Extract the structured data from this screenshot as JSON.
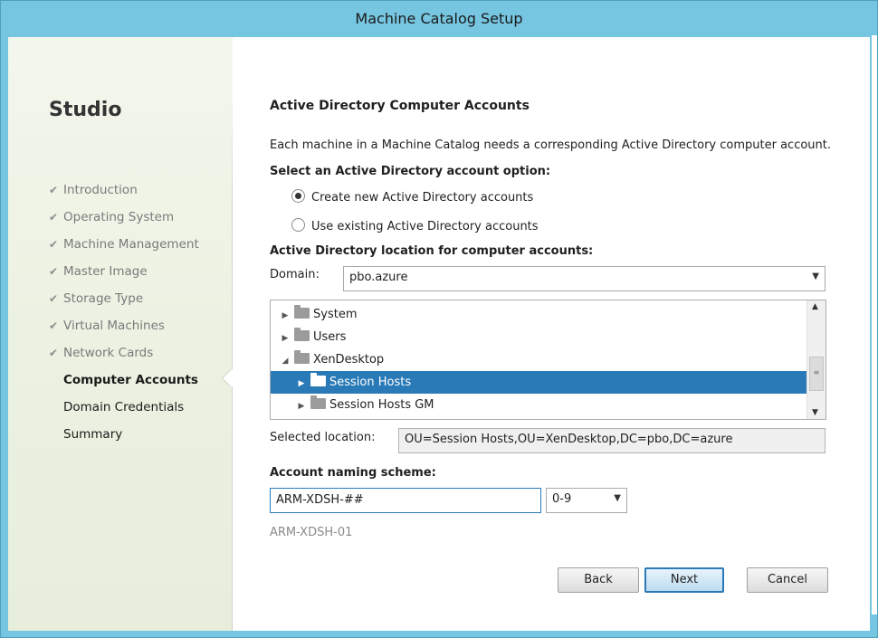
{
  "window": {
    "title": "Machine Catalog Setup"
  },
  "sidebar": {
    "brand": "Studio",
    "steps": [
      {
        "label": "Introduction",
        "state": "done"
      },
      {
        "label": "Operating System",
        "state": "done"
      },
      {
        "label": "Machine Management",
        "state": "done"
      },
      {
        "label": "Master Image",
        "state": "done"
      },
      {
        "label": "Storage Type",
        "state": "done"
      },
      {
        "label": "Virtual Machines",
        "state": "done"
      },
      {
        "label": "Network Cards",
        "state": "done"
      },
      {
        "label": "Computer Accounts",
        "state": "current"
      },
      {
        "label": "Domain Credentials",
        "state": "todo"
      },
      {
        "label": "Summary",
        "state": "todo"
      }
    ]
  },
  "main": {
    "heading": "Active Directory Computer Accounts",
    "description": "Each machine in a Machine Catalog needs a corresponding Active Directory computer account.",
    "option_label": "Select an Active Directory account option:",
    "options": [
      {
        "label": "Create new Active Directory accounts",
        "selected": true
      },
      {
        "label": "Use existing Active Directory accounts",
        "selected": false
      }
    ],
    "location_label": "Active Directory location for computer accounts:",
    "domain_label": "Domain:",
    "domain_value": "pbo.azure",
    "tree": [
      {
        "label": "System",
        "expanded": false,
        "selected": false
      },
      {
        "label": "Users",
        "expanded": false,
        "selected": false
      },
      {
        "label": "XenDesktop",
        "expanded": true,
        "selected": false
      },
      {
        "label": "Session Hosts",
        "expanded": false,
        "selected": true
      },
      {
        "label": "Session Hosts GM",
        "expanded": false,
        "selected": false
      }
    ],
    "selected_location_label": "Selected location:",
    "selected_location_value": "OU=Session Hosts,OU=XenDesktop,DC=pbo,DC=azure",
    "naming_label": "Account naming scheme:",
    "naming_value": "ARM-XDSH-##",
    "naming_type": "0-9",
    "naming_preview": "ARM-XDSH-01"
  },
  "buttons": {
    "back": "Back",
    "next": "Next",
    "cancel": "Cancel"
  },
  "icons": {
    "check": "check-icon",
    "collapsed": "expand-arrow-icon",
    "expanded": "collapse-arrow-icon",
    "folder": "folder-icon",
    "dropdown": "chevron-down-icon"
  },
  "colors": {
    "titlebar": "#76c6e2",
    "selection": "#2a7ab8",
    "sidebar": "#eef3e6"
  }
}
